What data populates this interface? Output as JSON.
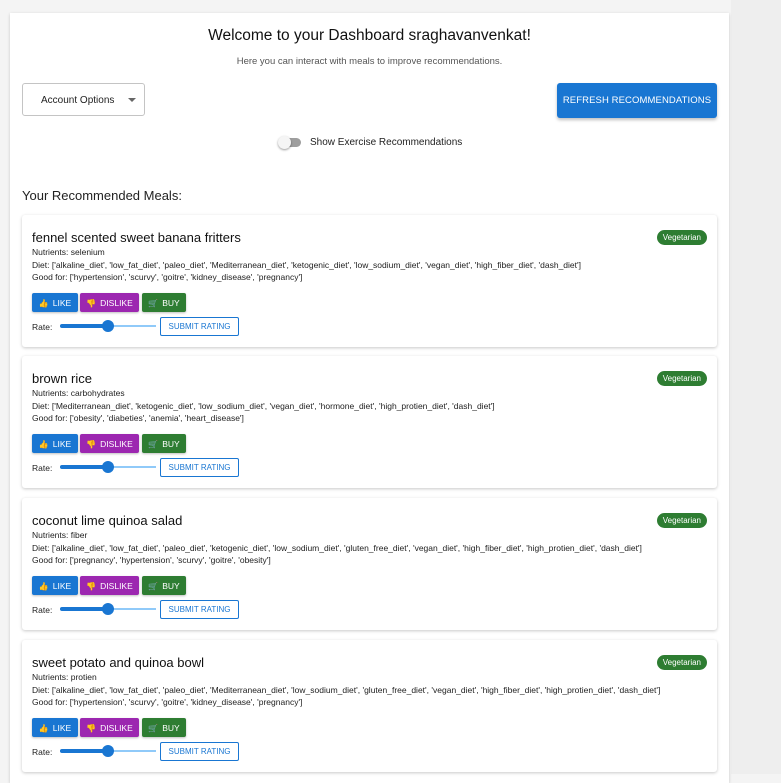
{
  "header": {
    "title": "Welcome to your Dashboard sraghavanvenkat!",
    "subtitle": "Here you can interact with meals to improve recommendations."
  },
  "controls": {
    "account_options": "Account Options",
    "refresh_label": "REFRESH RECOMMENDATIONS",
    "exercise_toggle_label": "Show Exercise Recommendations",
    "exercise_toggle_on": false
  },
  "section_title": "Your Recommended Meals:",
  "labels": {
    "like": "LIKE",
    "dislike": "DISLIKE",
    "buy": "BUY",
    "rate": "Rate:",
    "submit": "SUBMIT RATING"
  },
  "colors": {
    "primary": "#1976d2",
    "dislike": "#9c27b0",
    "buy": "#2e7d32",
    "badge": "#2e7d32"
  },
  "meals": [
    {
      "name": "fennel scented sweet banana fritters",
      "badge": "Vegetarian",
      "nutrients": "Nutrients: selenium",
      "diet": "Diet: ['alkaline_diet', 'low_fat_diet', 'paleo_diet', 'Mediterranean_diet', 'ketogenic_diet', 'low_sodium_diet', 'vegan_diet', 'high_fiber_diet', 'dash_diet']",
      "good_for": "Good for: ['hypertension', 'scurvy', 'goitre', 'kidney_disease', 'pregnancy']",
      "rating_fraction": 0.5
    },
    {
      "name": "brown rice",
      "badge": "Vegetarian",
      "nutrients": "Nutrients: carbohydrates",
      "diet": "Diet: ['Mediterranean_diet', 'ketogenic_diet', 'low_sodium_diet', 'vegan_diet', 'hormone_diet', 'high_protien_diet', 'dash_diet']",
      "good_for": "Good for: ['obesity', 'diabeties', 'anemia', 'heart_disease']",
      "rating_fraction": 0.5
    },
    {
      "name": "coconut lime quinoa salad",
      "badge": "Vegetarian",
      "nutrients": "Nutrients: fiber",
      "diet": "Diet: ['alkaline_diet', 'low_fat_diet', 'paleo_diet', 'ketogenic_diet', 'low_sodium_diet', 'gluten_free_diet', 'vegan_diet', 'high_fiber_diet', 'high_protien_diet', 'dash_diet']",
      "good_for": "Good for: ['pregnancy', 'hypertension', 'scurvy', 'goitre', 'obesity']",
      "rating_fraction": 0.5
    },
    {
      "name": "sweet potato and quinoa bowl",
      "badge": "Vegetarian",
      "nutrients": "Nutrients: protien",
      "diet": "Diet: ['alkaline_diet', 'low_fat_diet', 'paleo_diet', 'Mediterranean_diet', 'low_sodium_diet', 'gluten_free_diet', 'vegan_diet', 'high_fiber_diet', 'high_protien_diet', 'dash_diet']",
      "good_for": "Good for: ['hypertension', 'scurvy', 'goitre', 'kidney_disease', 'pregnancy']",
      "rating_fraction": 0.5
    }
  ]
}
